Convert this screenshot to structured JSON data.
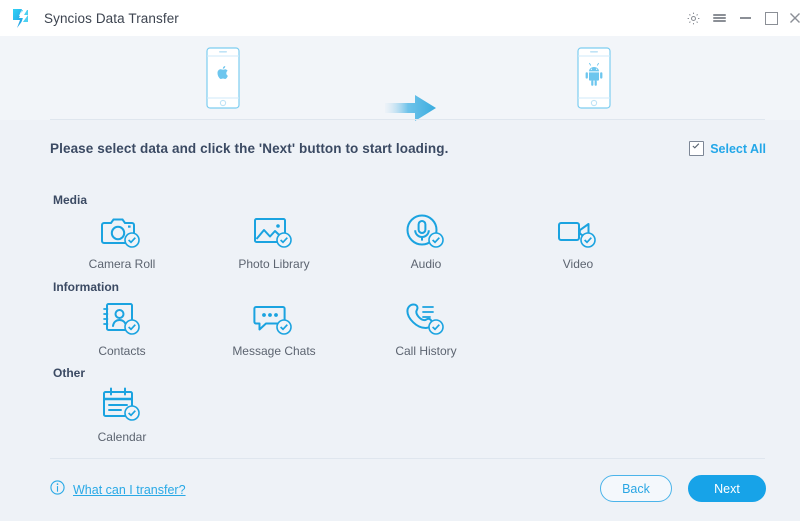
{
  "window": {
    "title": "Syncios Data Transfer",
    "logo_icon": "syncios-lightning-logo",
    "controls": [
      {
        "name": "settings",
        "icon": "gear-icon"
      },
      {
        "name": "menu",
        "icon": "hamburger-menu-icon"
      },
      {
        "name": "minimize",
        "icon": "minimize-icon"
      },
      {
        "name": "maximize",
        "icon": "maximize-icon"
      },
      {
        "name": "close",
        "icon": "close-icon"
      }
    ]
  },
  "devices": {
    "source": {
      "icon": "apple-phone-icon",
      "platform": "iOS"
    },
    "arrow": {
      "icon": "arrow-right-icon"
    },
    "destination": {
      "icon": "android-phone-icon",
      "platform": "Android"
    }
  },
  "main": {
    "instruction": "Please select data and click the 'Next' button to start loading.",
    "select_all": {
      "label": "Select All",
      "checked": true,
      "icon": "checkbox-checked-icon"
    },
    "groups": [
      {
        "title": "Media",
        "items": [
          {
            "label": "Camera Roll",
            "icon": "camera-icon",
            "checked": true
          },
          {
            "label": "Photo Library",
            "icon": "photo-library-icon",
            "checked": true
          },
          {
            "label": "Audio",
            "icon": "microphone-icon",
            "checked": true
          },
          {
            "label": "Video",
            "icon": "video-camera-icon",
            "checked": true
          }
        ]
      },
      {
        "title": "Information",
        "items": [
          {
            "label": "Contacts",
            "icon": "contact-card-icon",
            "checked": true
          },
          {
            "label": "Message Chats",
            "icon": "chat-bubble-icon",
            "checked": true
          },
          {
            "label": "Call History",
            "icon": "phone-handset-icon",
            "checked": true
          }
        ]
      },
      {
        "title": "Other",
        "items": [
          {
            "label": "Calendar",
            "icon": "calendar-icon",
            "checked": true
          }
        ]
      }
    ]
  },
  "footer": {
    "help_link": "What can I transfer?",
    "help_icon": "info-circle-icon",
    "back_label": "Back",
    "next_label": "Next"
  },
  "colors": {
    "accent": "#17a3e8",
    "accent_light": "#29a9e6",
    "icon_blue": "#1aa3e0",
    "text_dark": "#3b4a63",
    "text_muted": "#5c6470",
    "background": "#eef2f7",
    "titlebar": "#ffffff",
    "divider": "#dfe6ee"
  }
}
